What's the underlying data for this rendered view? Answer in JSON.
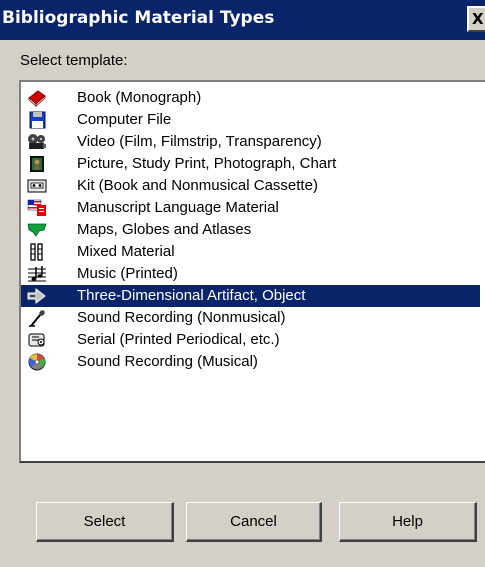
{
  "window": {
    "title": "Bibliographic Material Types",
    "close_label": "X"
  },
  "prompt": "Select template:",
  "list": {
    "selected_index": 9,
    "items": [
      {
        "label": "Book (Monograph)",
        "icon": "book-icon"
      },
      {
        "label": "Computer File",
        "icon": "floppy-disk-icon"
      },
      {
        "label": "Video (Film, Filmstrip, Transparency)",
        "icon": "film-projector-icon"
      },
      {
        "label": "Picture, Study Print, Photograph, Chart",
        "icon": "picture-icon"
      },
      {
        "label": "Kit (Book and Nonmusical Cassette)",
        "icon": "cassette-icon"
      },
      {
        "label": "Manuscript Language Material",
        "icon": "manuscript-flag-icon"
      },
      {
        "label": "Maps, Globes and Atlases",
        "icon": "map-icon"
      },
      {
        "label": "Mixed Material",
        "icon": "mixed-material-icon"
      },
      {
        "label": "Music (Printed)",
        "icon": "music-score-icon"
      },
      {
        "label": "Three-Dimensional Artifact, Object",
        "icon": "artifact-icon"
      },
      {
        "label": "Sound Recording (Nonmusical)",
        "icon": "microphone-icon"
      },
      {
        "label": "Serial (Printed Periodical, etc.)",
        "icon": "scroll-icon"
      },
      {
        "label": "Sound Recording (Musical)",
        "icon": "compact-disc-icon"
      }
    ]
  },
  "buttons": {
    "select": "Select",
    "cancel": "Cancel",
    "help": "Help"
  },
  "colors": {
    "titlebar": "#0a246a",
    "selection": "#0a246a",
    "face": "#d4d0c8"
  }
}
